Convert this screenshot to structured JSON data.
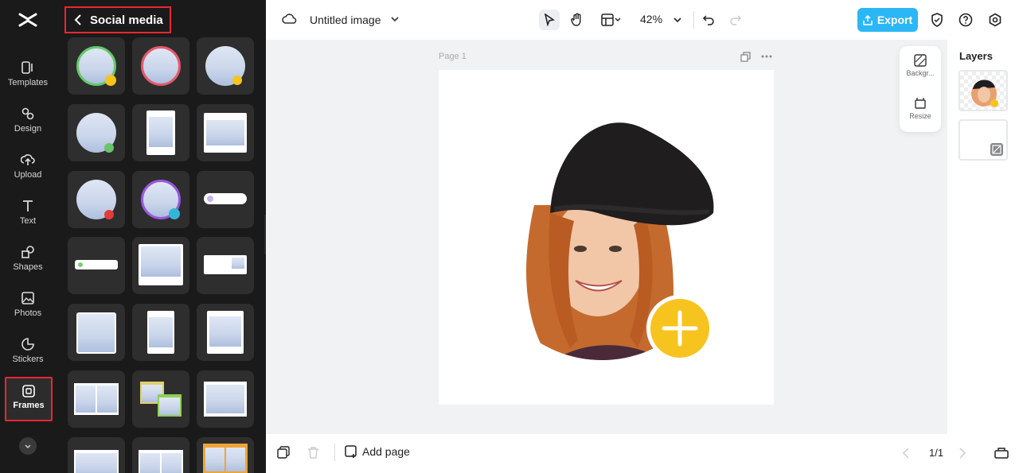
{
  "rail": {
    "items": [
      {
        "label": "Templates",
        "icon": "templates-icon"
      },
      {
        "label": "Design",
        "icon": "design-icon"
      },
      {
        "label": "Upload",
        "icon": "upload-icon"
      },
      {
        "label": "Text",
        "icon": "text-icon"
      },
      {
        "label": "Shapes",
        "icon": "shapes-icon"
      },
      {
        "label": "Photos",
        "icon": "photos-icon"
      },
      {
        "label": "Stickers",
        "icon": "stickers-icon"
      },
      {
        "label": "Frames",
        "icon": "frames-icon",
        "active": true
      }
    ]
  },
  "panel": {
    "title": "Social media"
  },
  "topbar": {
    "doc_title": "Untitled image",
    "zoom": "42%",
    "export_label": "Export"
  },
  "canvas": {
    "page_label": "Page 1"
  },
  "float_tools": {
    "background_label": "Backgr...",
    "resize_label": "Resize"
  },
  "layers": {
    "title": "Layers"
  },
  "bottombar": {
    "add_page_label": "Add page",
    "page_counter": "1/1"
  },
  "colors": {
    "accent": "#2bb7f5",
    "highlight": "#e8282f",
    "badge_yellow": "#f7c31e"
  }
}
